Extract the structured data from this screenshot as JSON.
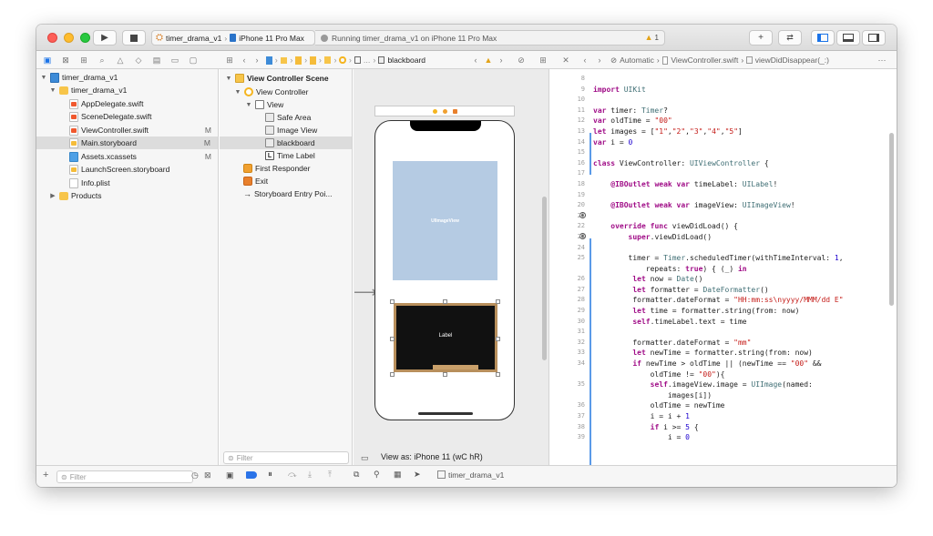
{
  "toolbar": {
    "scheme_target": "timer_drama_v1",
    "scheme_device": "iPhone 11 Pro Max",
    "activity_text": "Running timer_drama_v1 on iPhone 11 Pro Max",
    "warning_count": "1"
  },
  "editor_jumpbar": {
    "mode": "Automatic",
    "file": "ViewController.swift",
    "symbol": "viewDidDisappear(_:)"
  },
  "storyboard_jumpbar": {
    "current": "blackboard"
  },
  "navigator": {
    "items": [
      {
        "label": "timer_drama_v1",
        "badge": ""
      },
      {
        "label": "timer_drama_v1",
        "badge": ""
      },
      {
        "label": "AppDelegate.swift",
        "badge": ""
      },
      {
        "label": "SceneDelegate.swift",
        "badge": ""
      },
      {
        "label": "ViewController.swift",
        "badge": "M"
      },
      {
        "label": "Main.storyboard",
        "badge": "M"
      },
      {
        "label": "Assets.xcassets",
        "badge": "M"
      },
      {
        "label": "LaunchScreen.storyboard",
        "badge": ""
      },
      {
        "label": "Info.plist",
        "badge": ""
      },
      {
        "label": "Products",
        "badge": ""
      }
    ],
    "filter_placeholder": "Filter"
  },
  "outline": {
    "items": [
      {
        "label": "View Controller Scene"
      },
      {
        "label": "View Controller"
      },
      {
        "label": "View"
      },
      {
        "label": "Safe Area"
      },
      {
        "label": "Image View"
      },
      {
        "label": "blackboard"
      },
      {
        "label": "Time Label"
      },
      {
        "label": "First Responder"
      },
      {
        "label": "Exit"
      },
      {
        "label": "Storyboard Entry Poi..."
      }
    ],
    "filter_placeholder": "Filter"
  },
  "canvas": {
    "image_view_label": "UIImageView",
    "blackboard_label": "Label",
    "view_as": "View as: iPhone 11 (wC hR)"
  },
  "debug": {
    "target": "timer_drama_v1"
  },
  "code": {
    "lines": [
      {
        "n": "8",
        "t": ""
      },
      {
        "n": "9",
        "t": "import UIKit"
      },
      {
        "n": "10",
        "t": ""
      },
      {
        "n": "11",
        "t": "var timer: Timer?"
      },
      {
        "n": "12",
        "t": "var oldTime = \"00\""
      },
      {
        "n": "13",
        "t": "let images = [\"1\",\"2\",\"3\",\"4\",\"5\"]"
      },
      {
        "n": "14",
        "t": "var i = 0"
      },
      {
        "n": "15",
        "t": ""
      },
      {
        "n": "16",
        "t": "class ViewController: UIViewController {"
      },
      {
        "n": "17",
        "t": ""
      },
      {
        "n": "18",
        "t": "    @IBOutlet weak var timeLabel: UILabel!"
      },
      {
        "n": "19",
        "t": ""
      },
      {
        "n": "20",
        "t": "    @IBOutlet weak var imageView: UIImageView!"
      },
      {
        "n": "21",
        "t": ""
      },
      {
        "n": "22",
        "t": "    override func viewDidLoad() {"
      },
      {
        "n": "23",
        "t": "        super.viewDidLoad()"
      },
      {
        "n": "24",
        "t": ""
      },
      {
        "n": "25",
        "t": "        timer = Timer.scheduledTimer(withTimeInterval: 1,"
      },
      {
        "n": "",
        "t": "            repeats: true) { (_) in"
      },
      {
        "n": "26",
        "t": "         let now = Date()"
      },
      {
        "n": "27",
        "t": "         let formatter = DateFormatter()"
      },
      {
        "n": "28",
        "t": "         formatter.dateFormat = \"HH:mm:ss\\nyyyy/MMM/dd E\""
      },
      {
        "n": "29",
        "t": "         let time = formatter.string(from: now)"
      },
      {
        "n": "30",
        "t": "         self.timeLabel.text = time"
      },
      {
        "n": "31",
        "t": ""
      },
      {
        "n": "32",
        "t": "         formatter.dateFormat = \"mm\""
      },
      {
        "n": "33",
        "t": "         let newTime = formatter.string(from: now)"
      },
      {
        "n": "34",
        "t": "         if newTime > oldTime || (newTime == \"00\" &&"
      },
      {
        "n": "",
        "t": "             oldTime != \"00\"){"
      },
      {
        "n": "35",
        "t": "             self.imageView.image = UIImage(named:"
      },
      {
        "n": "",
        "t": "                 images[i])"
      },
      {
        "n": "36",
        "t": "             oldTime = newTime"
      },
      {
        "n": "37",
        "t": "             i = i + 1"
      },
      {
        "n": "38",
        "t": "             if i >= 5 {"
      },
      {
        "n": "39",
        "t": "                 i = 0"
      }
    ]
  }
}
